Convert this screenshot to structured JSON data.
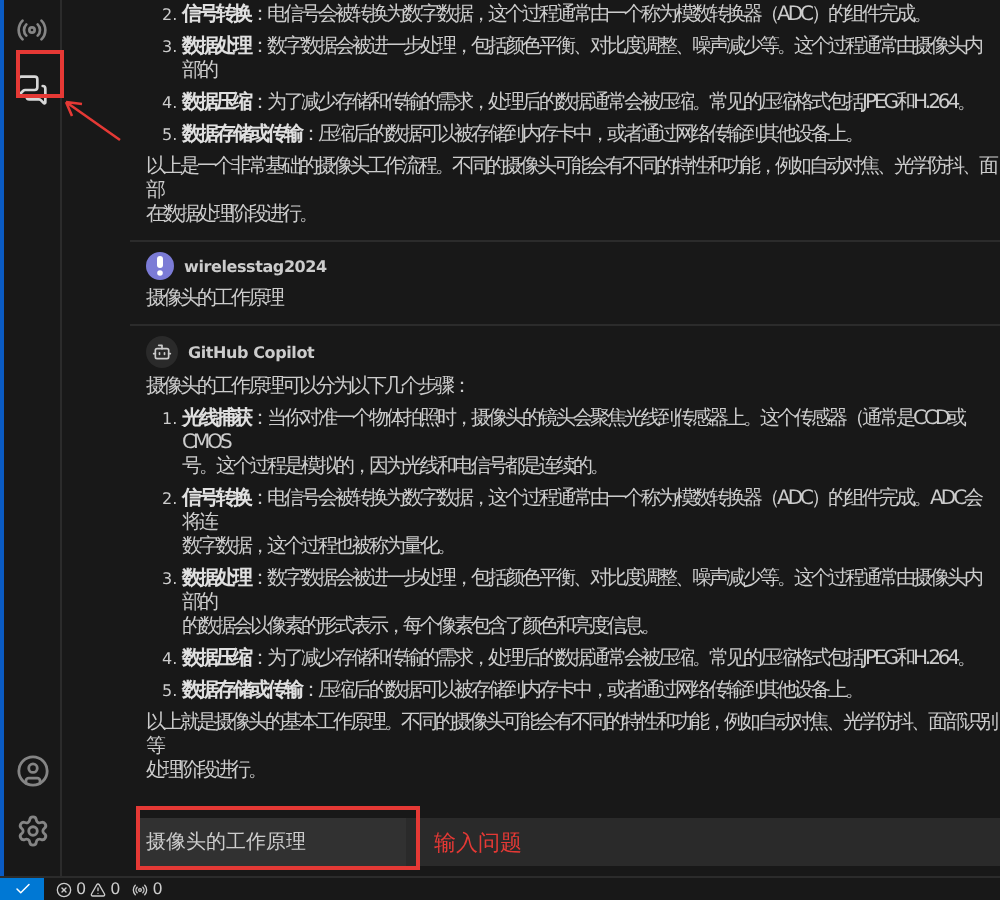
{
  "activity_bar": {
    "items": [
      {
        "kind": "remote",
        "selected": false
      },
      {
        "kind": "chat",
        "selected": true
      }
    ],
    "bottom": [
      {
        "kind": "account"
      },
      {
        "kind": "settings"
      }
    ]
  },
  "messages": [
    {
      "blocks": [
        {
          "kind": "list_item",
          "number": "2.",
          "lines": [
            "**信号转换**：电信号会被转换为数字数据，这个过程通常由一个称为模数转换器（ADC）的组件完成。"
          ]
        },
        {
          "kind": "list_item",
          "number": "3.",
          "lines": [
            "**数据处理**：数字数据会被进一步处理，包括颜色平衡、对比度调整、噪声减少等。这个过程通常由摄像头内部的"
          ]
        },
        {
          "kind": "list_item",
          "number": "4.",
          "lines": [
            "**数据压缩**：为了减少存储和传输的需求，处理后的数据通常会被压缩。常见的压缩格式包括JPEG和H.264。"
          ]
        },
        {
          "kind": "list_item",
          "number": "5.",
          "lines": [
            "**数据存储或传输**：压缩后的数据可以被存储到内存卡中，或者通过网络传输到其他设备上。"
          ]
        },
        {
          "kind": "paragraph",
          "lines": [
            "以上是一个非常基础的摄像头工作流程。不同的摄像头可能会有不同的特性和功能，例如自动对焦、光学防抖、面部",
            "在数据处理阶段进行。"
          ]
        }
      ]
    },
    {
      "author": {
        "kind": "user",
        "name": "wirelesstag2024"
      },
      "blocks": [
        {
          "kind": "paragraph",
          "lines": [
            "摄像头的工作原理"
          ]
        }
      ]
    },
    {
      "author": {
        "kind": "assistant",
        "name": "GitHub Copilot"
      },
      "blocks": [
        {
          "kind": "paragraph",
          "lines": [
            "摄像头的工作原理可以分为以下几个步骤："
          ]
        },
        {
          "kind": "list_item",
          "number": "1.",
          "lines": [
            "**光线捕获**：当你对准一个物体拍照时，摄像头的镜头会聚焦光线到传感器上。这个传感器（通常是CCD或CMOS",
            "号。这个过程是模拟的，因为光线和电信号都是连续的。"
          ]
        },
        {
          "kind": "list_item",
          "number": "2.",
          "lines": [
            "**信号转换**：电信号会被转换为数字数据，这个过程通常由一个称为模数转换器（ADC）的组件完成。ADC会将连",
            "数字数据，这个过程也被称为量化。"
          ]
        },
        {
          "kind": "list_item",
          "number": "3.",
          "lines": [
            "**数据处理**：数字数据会被进一步处理，包括颜色平衡、对比度调整、噪声减少等。这个过程通常由摄像头内部的",
            "的数据会以像素的形式表示，每个像素包含了颜色和亮度信息。"
          ]
        },
        {
          "kind": "list_item",
          "number": "4.",
          "lines": [
            "**数据压缩**：为了减少存储和传输的需求，处理后的数据通常会被压缩。常见的压缩格式包括JPEG和H.264。"
          ]
        },
        {
          "kind": "list_item",
          "number": "5.",
          "lines": [
            "**数据存储或传输**：压缩后的数据可以被存储到内存卡中，或者通过网络传输到其他设备上。"
          ]
        },
        {
          "kind": "paragraph",
          "lines": [
            "以上就是摄像头的基本工作原理。不同的摄像头可能会有不同的特性和功能，例如自动对焦、光学防抖、面部识别等",
            "处理阶段进行。"
          ]
        }
      ]
    }
  ],
  "input": {
    "value": "摄像头的工作原理"
  },
  "annotation": {
    "text": "输入问题"
  },
  "status_bar": {
    "errors": "0",
    "warnings": "0",
    "ports": "0"
  }
}
